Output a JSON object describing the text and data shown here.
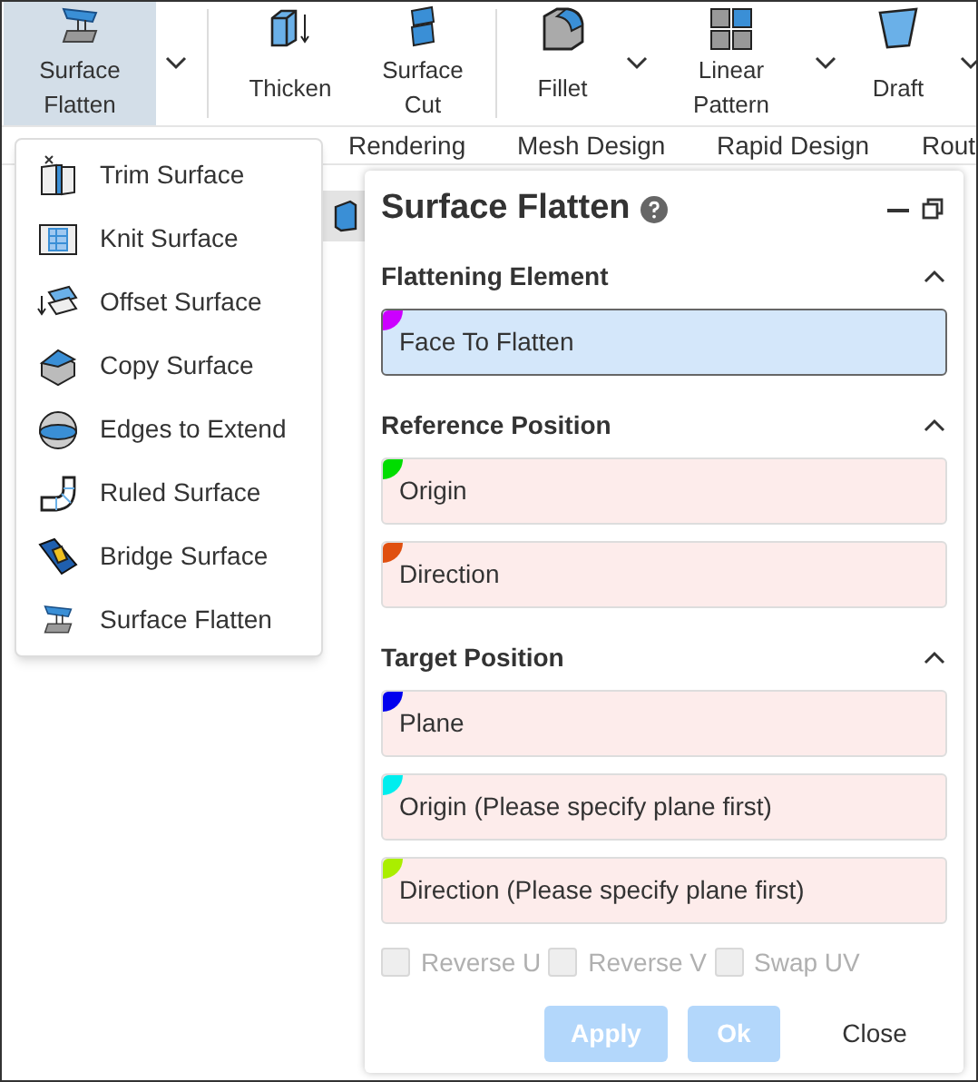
{
  "ribbon": {
    "buttons": [
      {
        "label": "Surface\nFlatten",
        "selected": true,
        "dropdown": true
      },
      {
        "label": "Thicken",
        "selected": false,
        "dropdown": false
      },
      {
        "label": "Surface\nCut",
        "selected": false,
        "dropdown": false
      },
      {
        "label": "Fillet",
        "selected": false,
        "dropdown": true
      },
      {
        "label": "Linear\nPattern",
        "selected": false,
        "dropdown": true
      },
      {
        "label": "Draft",
        "selected": false,
        "dropdown": true
      }
    ]
  },
  "tabs": [
    "Rendering",
    "Mesh Design",
    "Rapid Design",
    "Rout"
  ],
  "menu": {
    "items": [
      {
        "label": "Trim Surface"
      },
      {
        "label": "Knit Surface"
      },
      {
        "label": "Offset Surface"
      },
      {
        "label": "Copy Surface"
      },
      {
        "label": "Edges to Extend"
      },
      {
        "label": "Ruled Surface"
      },
      {
        "label": "Bridge Surface"
      },
      {
        "label": "Surface Flatten"
      }
    ]
  },
  "panel": {
    "title": "Surface Flatten",
    "sections": [
      {
        "title": "Flattening Element",
        "expanded": true,
        "fields": [
          {
            "label": "Face To Flatten",
            "color": "#cc00ff",
            "selected": true
          }
        ]
      },
      {
        "title": "Reference Position",
        "expanded": true,
        "fields": [
          {
            "label": "Origin",
            "color": "#00dd00",
            "selected": false
          },
          {
            "label": "Direction",
            "color": "#e05010",
            "selected": false
          }
        ]
      },
      {
        "title": "Target Position",
        "expanded": true,
        "fields": [
          {
            "label": "Plane",
            "color": "#0000ee",
            "selected": false
          },
          {
            "label": "Origin (Please specify plane first)",
            "color": "#00eeee",
            "selected": false
          },
          {
            "label": "Direction (Please specify plane first)",
            "color": "#aaee00",
            "selected": false
          }
        ]
      }
    ],
    "options": [
      {
        "label": "Reverse U",
        "checked": false,
        "disabled": true
      },
      {
        "label": "Reverse V",
        "checked": false,
        "disabled": true
      },
      {
        "label": "Swap UV",
        "checked": false,
        "disabled": true
      }
    ],
    "buttons": [
      {
        "label": "Apply",
        "kind": "primary",
        "disabled": true
      },
      {
        "label": "Ok",
        "kind": "primary",
        "disabled": true
      },
      {
        "label": "Close",
        "kind": "plain",
        "disabled": false
      }
    ]
  }
}
